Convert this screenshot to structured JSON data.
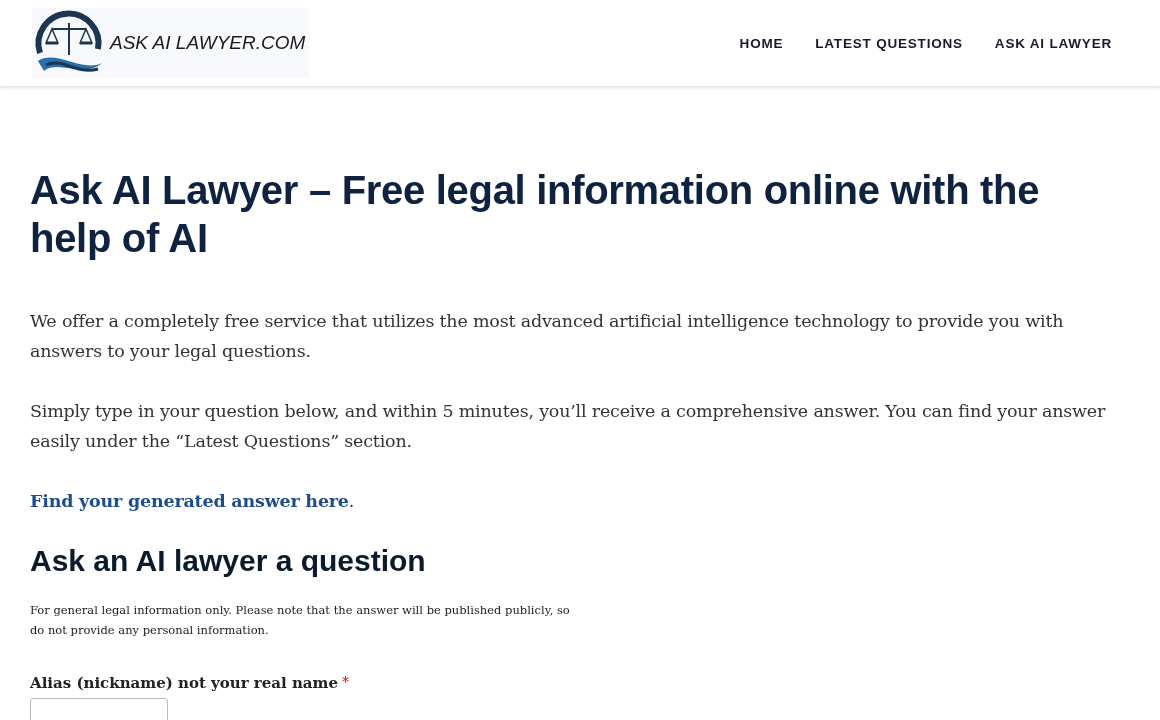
{
  "header": {
    "logo_text": "ASK AI LAWYER.COM",
    "nav": [
      "HOME",
      "LATEST QUESTIONS",
      "ASK AI LAWYER"
    ]
  },
  "title": "Ask AI Lawyer – Free legal information online with the help of AI",
  "paragraphs": [
    "We offer a completely free service that utilizes the most advanced artificial intelligence technology to provide you with answers to your legal questions.",
    "Simply type in your question below, and within 5 minutes, you’ll receive a comprehensive answer. You can find your answer easily under the “Latest Questions” section."
  ],
  "answer_link": {
    "link": "Find your generated answer here",
    "after": "."
  },
  "form": {
    "heading": "Ask an AI lawyer a question",
    "note": "For general legal information only. Please note that the answer will be published publicly, so do not provide any personal information.",
    "fields": [
      {
        "label": "Alias (nickname) not your real name",
        "required_mark": "*"
      }
    ]
  }
}
